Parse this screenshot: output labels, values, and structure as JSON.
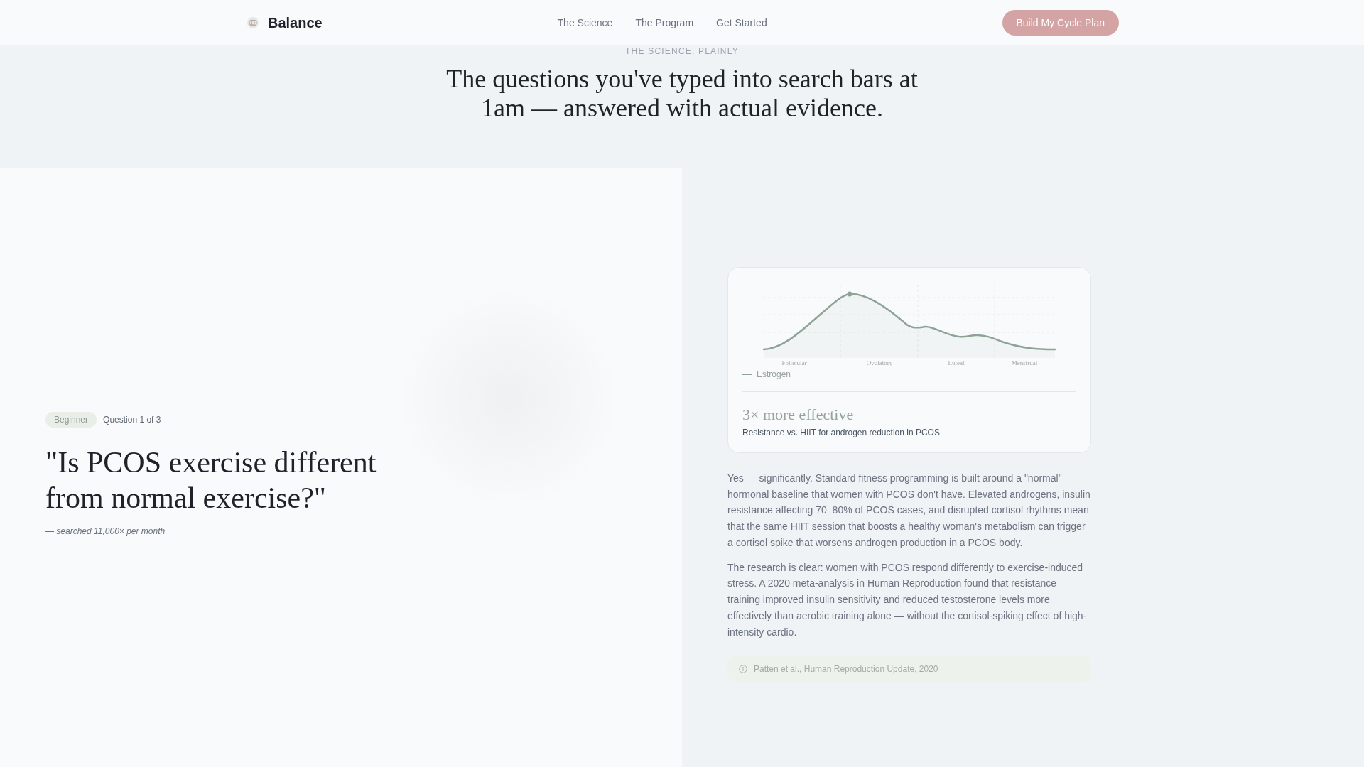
{
  "header": {
    "brand": "Balance",
    "nav": [
      "The Science",
      "The Program",
      "Get Started"
    ],
    "cta": "Build My Cycle Plan"
  },
  "hero": {
    "eyebrow": "THE SCIENCE, PLAINLY",
    "title": "The questions you've typed into search bars at 1am — answered with actual evidence."
  },
  "question": {
    "difficulty": "Beginner",
    "counter": "Question 1 of 3",
    "text": "\"Is PCOS exercise different from normal exercise?\"",
    "note": "— searched 11,000× per month"
  },
  "evidence_card": {
    "chart": {
      "phase_labels": [
        "Follicular",
        "Ovulatory",
        "Luteal",
        "Menstrual"
      ],
      "legend": "Estrogen"
    },
    "stat": "3× more effective",
    "stat_caption": "Resistance vs. HIIT for androgen reduction in PCOS"
  },
  "answer": {
    "paragraphs": [
      "Yes — significantly. Standard fitness programming is built around a \"normal\" hormonal baseline that women with PCOS don't have. Elevated androgens, insulin resistance affecting 70–80% of PCOS cases, and disrupted cortisol rhythms mean that the same HIIT session that boosts a healthy woman's metabolism can trigger a cortisol spike that worsens androgen production in a PCOS body.",
      "The research is clear: women with PCOS respond differently to exercise-induced stress. A 2020 meta-analysis in Human Reproduction found that resistance training improved insulin sensitivity and reduced testosterone levels more effectively than aerobic training alone — without the cortisol-spiking effect of high-intensity cardio."
    ],
    "citation": "Patten et al., Human Reproduction Update, 2020"
  }
}
